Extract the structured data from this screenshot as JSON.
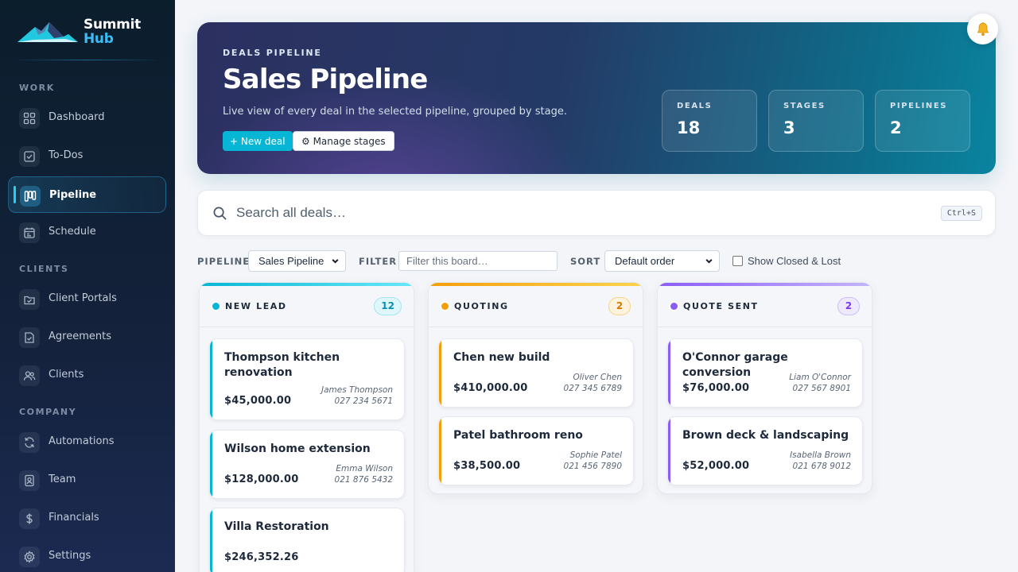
{
  "brand": {
    "line1": "Summit",
    "line2": "Hub"
  },
  "nav": {
    "sections": {
      "work": "WORK",
      "clients": "CLIENTS",
      "company": "COMPANY"
    },
    "items": [
      {
        "label": "Dashboard",
        "icon": "grid-icon"
      },
      {
        "label": "To-Dos",
        "icon": "checkbox-icon"
      },
      {
        "label": "Pipeline",
        "icon": "kanban-icon",
        "active": true
      },
      {
        "label": "Schedule",
        "icon": "calendar-icon"
      },
      {
        "label": "Client Portals",
        "icon": "folder-check-icon"
      },
      {
        "label": "Agreements",
        "icon": "file-check-icon"
      },
      {
        "label": "Clients",
        "icon": "users-icon"
      },
      {
        "label": "Automations",
        "icon": "refresh-icon"
      },
      {
        "label": "Team",
        "icon": "id-badge-icon"
      },
      {
        "label": "Financials",
        "icon": "dollar-icon"
      },
      {
        "label": "Settings",
        "icon": "gear-icon"
      }
    ]
  },
  "hero": {
    "eyebrow": "DEALS PIPELINE",
    "title": "Sales Pipeline",
    "description": "Live view of every deal in the selected pipeline, grouped by stage.",
    "new_deal": "+ New deal",
    "manage_stages": "⚙ Manage stages",
    "stats": [
      {
        "label": "DEALS",
        "value": "18"
      },
      {
        "label": "STAGES",
        "value": "3"
      },
      {
        "label": "PIPELINES",
        "value": "2"
      }
    ]
  },
  "search": {
    "placeholder": "Search all deals…",
    "shortcut": "Ctrl+S"
  },
  "toolbar": {
    "pipeline_label": "PIPELINE",
    "pipeline_value": "Sales Pipeline",
    "filter_label": "FILTER",
    "filter_placeholder": "Filter this board…",
    "sort_label": "SORT",
    "sort_value": "Default order",
    "show_closed": "Show Closed & Lost"
  },
  "columns": [
    {
      "title": "NEW LEAD",
      "count": "12",
      "color": "#06b6d4",
      "cards": [
        {
          "name": "Thompson kitchen renovation",
          "amount": "$45,000.00",
          "contact": "James Thompson",
          "phone": "027 234 5671"
        },
        {
          "name": "Wilson home extension",
          "amount": "$128,000.00",
          "contact": "Emma Wilson",
          "phone": "021 876 5432"
        },
        {
          "name": "Villa Restoration",
          "amount": "$246,352.26",
          "contact": "",
          "phone": ""
        }
      ]
    },
    {
      "title": "QUOTING",
      "count": "2",
      "color": "#f59e0b",
      "cards": [
        {
          "name": "Chen new build",
          "amount": "$410,000.00",
          "contact": "Oliver Chen",
          "phone": "027 345 6789"
        },
        {
          "name": "Patel bathroom reno",
          "amount": "$38,500.00",
          "contact": "Sophie Patel",
          "phone": "021 456 7890"
        }
      ]
    },
    {
      "title": "QUOTE SENT",
      "count": "2",
      "color": "#8b5cf6",
      "cards": [
        {
          "name": "O'Connor garage conversion",
          "amount": "$76,000.00",
          "contact": "Liam O'Connor",
          "phone": "027 567 8901"
        },
        {
          "name": "Brown deck & landscaping",
          "amount": "$52,000.00",
          "contact": "Isabella Brown",
          "phone": "021 678 9012"
        }
      ]
    }
  ]
}
